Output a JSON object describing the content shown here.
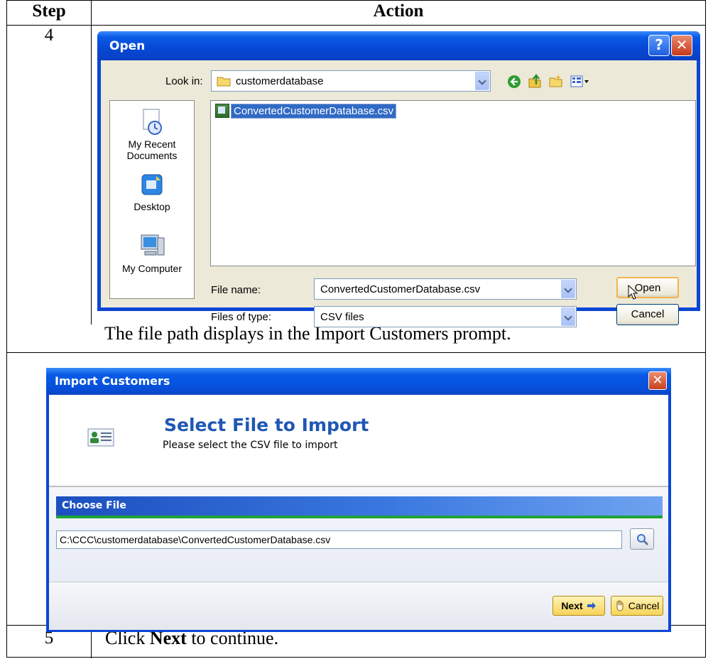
{
  "table": {
    "header_step": "Step",
    "header_action": "Action",
    "rows": [
      {
        "step": "4",
        "caption": "The file path displays in the Import Customers prompt."
      },
      {
        "step": "5",
        "instruction_pre": "Click ",
        "instruction_bold": "Next",
        "instruction_post": " to continue."
      }
    ]
  },
  "open_dialog": {
    "title": "Open",
    "help_glyph": "?",
    "close_glyph": "✕",
    "look_in_label": "Look in:",
    "look_in_value": "customerdatabase",
    "places": [
      "My Recent Documents",
      "Desktop",
      "My Computer"
    ],
    "places_lines": {
      "recent_1": "My Recent",
      "recent_2": "Documents"
    },
    "files": [
      "ConvertedCustomerDatabase.csv"
    ],
    "file_name_label": "File name:",
    "file_name_value": "ConvertedCustomerDatabase.csv",
    "file_type_label": "Files of type:",
    "file_type_value": "CSV files",
    "open_button": "Open",
    "cancel_button": "Cancel",
    "toolbar_icons": [
      "back-icon",
      "up-folder-icon",
      "new-folder-icon",
      "views-menu-icon"
    ]
  },
  "import_dialog": {
    "title": "Import Customers",
    "close_glyph": "✕",
    "heading": "Select File to Import",
    "subheading": "Please select the CSV file to import",
    "section_label": "Choose File",
    "path_value": "C:\\CCC\\customerdatabase\\ConvertedCustomerDatabase.csv",
    "next_button": "Next",
    "cancel_button": "Cancel"
  },
  "colors": {
    "xp_title_blue": "#0a46d6",
    "xp_face": "#ece9d8",
    "selection_blue": "#316ac5",
    "heading_blue": "#1f57b4",
    "accent_green": "#1fa33a",
    "button_yellow": "#f7d359"
  }
}
